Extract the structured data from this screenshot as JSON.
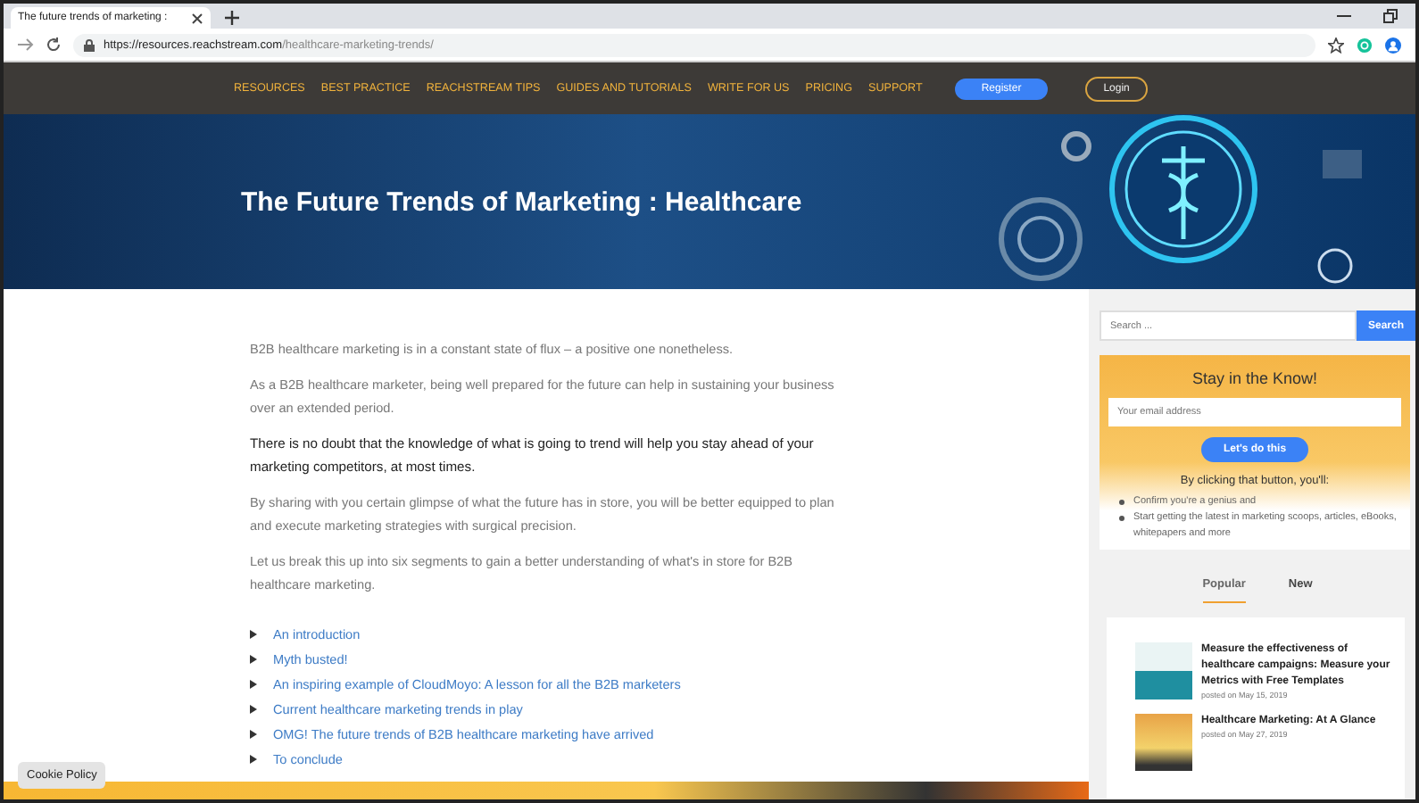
{
  "browser": {
    "tab_title": "The future trends of marketing :",
    "url_host": "https://resources.reachstream.com",
    "url_path": "/healthcare-marketing-trends/"
  },
  "nav": {
    "items": [
      "RESOURCES",
      "BEST PRACTICE",
      "REACHSTREAM TIPS",
      "GUIDES AND TUTORIALS",
      "WRITE FOR US",
      "PRICING",
      "SUPPORT"
    ],
    "register": "Register",
    "login": "Login"
  },
  "hero": {
    "title": "The Future Trends of Marketing : Healthcare"
  },
  "article": {
    "paragraphs": [
      {
        "kind": "normal",
        "text": "B2B healthcare marketing is in a constant state of flux – a positive one nonetheless."
      },
      {
        "kind": "normal",
        "text": "As a B2B healthcare marketer, being well prepared for the future can help in sustaining your business over an extended period."
      },
      {
        "kind": "emphasis",
        "text": "There is no doubt that the knowledge of what is going to trend will help you stay ahead of your marketing competitors, at most times."
      },
      {
        "kind": "normal",
        "text": "By sharing with you certain glimpse of what the future has in store, you will be better equipped to plan and execute marketing strategies with surgical precision."
      },
      {
        "kind": "normal",
        "text": "Let us break this up into six segments to gain a better understanding of what's in store for B2B healthcare marketing."
      }
    ],
    "toc": [
      "An introduction",
      "Myth busted!",
      "An inspiring example of CloudMoyo: A lesson for all the B2B marketers",
      "Current healthcare marketing trends in play",
      "OMG! The future trends of B2B healthcare marketing have arrived",
      "To conclude"
    ]
  },
  "sidebar": {
    "search": {
      "placeholder": "Search ...",
      "button": "Search"
    },
    "subscribe": {
      "title": "Stay in the Know!",
      "placeholder": "Your email address",
      "button": "Let's do this",
      "caption": "By clicking that button, you'll:",
      "bullets": [
        "Confirm you're a genius and",
        "Start getting the latest in marketing scoops, articles, eBooks, whitepapers and more"
      ]
    },
    "tabs": [
      {
        "label": "Popular",
        "selected": true
      },
      {
        "label": "New",
        "selected": false
      }
    ],
    "posts": [
      {
        "title": "Measure the effectiveness of healthcare campaigns: Measure your Metrics with Free Templates",
        "date": "posted on May 15, 2019"
      },
      {
        "title": "Healthcare Marketing: At A Glance",
        "date": "posted on May 27, 2019"
      }
    ]
  },
  "cookie": "Cookie Policy"
}
